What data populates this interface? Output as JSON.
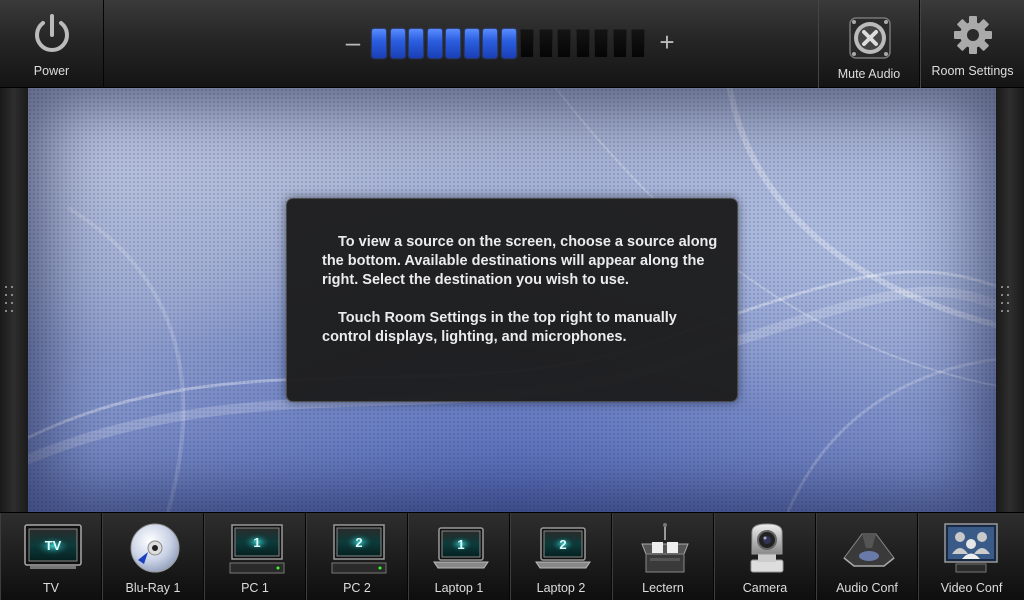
{
  "top": {
    "power_label": "Power",
    "mute_label": "Mute Audio",
    "room_label": "Room Settings"
  },
  "volume": {
    "minus": "–",
    "plus": "+",
    "level_segments": 8,
    "total_segments": 15,
    "accent_color": "#2b5fe0"
  },
  "info": {
    "paragraph1": "To view a source on the screen, choose a source along the bottom.  Available destinations will appear along the right.  Select the destination you wish to use.",
    "paragraph2": "Touch Room Settings in the top right to manually control displays, lighting, and microphones."
  },
  "sources": [
    {
      "label": "TV",
      "icon": "tv-icon",
      "badge": "TV"
    },
    {
      "label": "Blu-Ray 1",
      "icon": "bluray-disc-icon"
    },
    {
      "label": "PC 1",
      "icon": "pc-monitor-icon",
      "badge": "1"
    },
    {
      "label": "PC 2",
      "icon": "pc-monitor-icon",
      "badge": "2"
    },
    {
      "label": "Laptop 1",
      "icon": "laptop-icon",
      "badge": "1"
    },
    {
      "label": "Laptop 2",
      "icon": "laptop-icon",
      "badge": "2"
    },
    {
      "label": "Lectern",
      "icon": "lectern-icon"
    },
    {
      "label": "Camera",
      "icon": "camera-icon"
    },
    {
      "label": "Audio Conf",
      "icon": "conference-phone-icon"
    },
    {
      "label": "Video Conf",
      "icon": "video-conference-icon"
    }
  ]
}
